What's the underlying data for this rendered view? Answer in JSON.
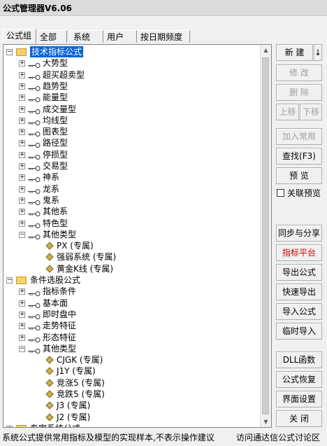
{
  "window": {
    "title": "公式管理器V6.06"
  },
  "tabs": [
    "公式组",
    "全部",
    "系统",
    "用户",
    "按日期频度"
  ],
  "tree": [
    {
      "label": "技术指标公式",
      "level": 0,
      "type": "folder",
      "expanded": true,
      "selected": true
    },
    {
      "label": "大势型",
      "level": 1,
      "type": "key"
    },
    {
      "label": "超买超卖型",
      "level": 1,
      "type": "key"
    },
    {
      "label": "趋势型",
      "level": 1,
      "type": "key"
    },
    {
      "label": "能量型",
      "level": 1,
      "type": "key"
    },
    {
      "label": "成交量型",
      "level": 1,
      "type": "key"
    },
    {
      "label": "均线型",
      "level": 1,
      "type": "key"
    },
    {
      "label": "图表型",
      "level": 1,
      "type": "key"
    },
    {
      "label": "路径型",
      "level": 1,
      "type": "key"
    },
    {
      "label": "停损型",
      "level": 1,
      "type": "key"
    },
    {
      "label": "交易型",
      "level": 1,
      "type": "key"
    },
    {
      "label": "神系",
      "level": 1,
      "type": "key"
    },
    {
      "label": "龙系",
      "level": 1,
      "type": "key"
    },
    {
      "label": "鬼系",
      "level": 1,
      "type": "key"
    },
    {
      "label": "其他系",
      "level": 1,
      "type": "key"
    },
    {
      "label": "特色型",
      "level": 1,
      "type": "key"
    },
    {
      "label": "其他类型",
      "level": 1,
      "type": "key",
      "expanded": true
    },
    {
      "label": "PX  (专属)",
      "level": 2,
      "type": "formula"
    },
    {
      "label": "强弱系统  (专属)",
      "level": 2,
      "type": "formula"
    },
    {
      "label": "黄金K线  (专属)",
      "level": 2,
      "type": "formula"
    },
    {
      "label": "条件选股公式",
      "level": 0,
      "type": "folder",
      "expanded": true
    },
    {
      "label": "指标条件",
      "level": 1,
      "type": "key"
    },
    {
      "label": "基本面",
      "level": 1,
      "type": "key"
    },
    {
      "label": "即时盘中",
      "level": 1,
      "type": "key"
    },
    {
      "label": "走势特征",
      "level": 1,
      "type": "key"
    },
    {
      "label": "形态特征",
      "level": 1,
      "type": "key"
    },
    {
      "label": "其他类型",
      "level": 1,
      "type": "key",
      "expanded": true
    },
    {
      "label": "CJGK  (专属)",
      "level": 2,
      "type": "formula"
    },
    {
      "label": "J1Y  (专属)",
      "level": 2,
      "type": "formula"
    },
    {
      "label": "竞涨5  (专属)",
      "level": 2,
      "type": "formula"
    },
    {
      "label": "竞跌5  (专属)",
      "level": 2,
      "type": "formula"
    },
    {
      "label": "J3  (专属)",
      "level": 2,
      "type": "formula"
    },
    {
      "label": "J2  (专属)",
      "level": 2,
      "type": "formula"
    },
    {
      "label": "专家系统公式",
      "level": 0,
      "type": "folder",
      "expanded": false
    }
  ],
  "buttons": {
    "new": "新 建",
    "new_dropdown": "↓",
    "modify": "修 改",
    "delete": "删 除",
    "move_up": "上移",
    "move_down": "下移",
    "add_common": "加入常用",
    "find": "查找(F3)",
    "preview": "预 览",
    "sync_share": "同步与分享",
    "indicator_platform": "指标平台",
    "export": "导出公式",
    "quick_export": "快速导出",
    "import": "导入公式",
    "temp_import": "临时导入",
    "dll": "DLL函数",
    "restore": "公式恢复",
    "ui_settings": "界面设置",
    "close": "关 闭"
  },
  "linked_preview": {
    "label": "关联预览",
    "checked": false
  },
  "status": {
    "left": "系统公式提供常用指标及模型的实现样本,不表示操作建议",
    "right": "访问通达信公式讨论区"
  },
  "colors": {
    "selection": "#0a64d8",
    "highlight_text": "#d00000"
  }
}
